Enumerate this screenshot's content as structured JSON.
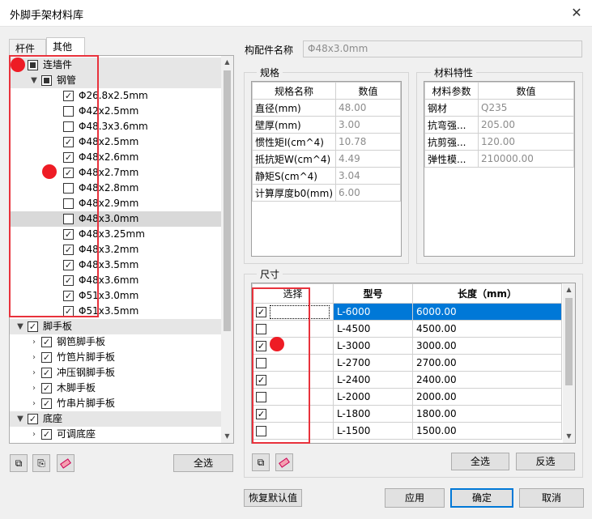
{
  "window": {
    "title": "外脚手架材料库",
    "close_glyph": "✕"
  },
  "tabs": [
    {
      "label": "杆件"
    },
    {
      "label": "其他"
    }
  ],
  "tree": [
    {
      "label": "连墙件",
      "arrow": "▼",
      "check": "partial",
      "indent": 0,
      "group": true
    },
    {
      "label": "钢管",
      "arrow": "▼",
      "check": "partial",
      "indent": 1,
      "group": true
    },
    {
      "label": "Φ26.8x2.5mm",
      "check": true,
      "indent": 2
    },
    {
      "label": "Φ42x2.5mm",
      "check": false,
      "indent": 2
    },
    {
      "label": "Φ48.3x3.6mm",
      "check": false,
      "indent": 2
    },
    {
      "label": "Φ48x2.5mm",
      "check": true,
      "indent": 2
    },
    {
      "label": "Φ48x2.6mm",
      "check": true,
      "indent": 2
    },
    {
      "label": "Φ48x2.7mm",
      "check": true,
      "indent": 2
    },
    {
      "label": "Φ48x2.8mm",
      "check": false,
      "indent": 2
    },
    {
      "label": "Φ48x2.9mm",
      "check": false,
      "indent": 2
    },
    {
      "label": "Φ48x3.0mm",
      "check": false,
      "indent": 2,
      "selected": true
    },
    {
      "label": "Φ48x3.25mm",
      "check": true,
      "indent": 2
    },
    {
      "label": "Φ48x3.2mm",
      "check": true,
      "indent": 2
    },
    {
      "label": "Φ48x3.5mm",
      "check": true,
      "indent": 2
    },
    {
      "label": "Φ48x3.6mm",
      "check": true,
      "indent": 2
    },
    {
      "label": "Φ51x3.0mm",
      "check": true,
      "indent": 2
    },
    {
      "label": "Φ51x3.5mm",
      "check": true,
      "indent": 2
    },
    {
      "label": "脚手板",
      "arrow": "▼",
      "check": true,
      "indent": 0,
      "group": true
    },
    {
      "label": "钢笆脚手板",
      "arrow": "›",
      "check": true,
      "indent": 1
    },
    {
      "label": "竹笆片脚手板",
      "arrow": "›",
      "check": true,
      "indent": 1
    },
    {
      "label": "冲压钢脚手板",
      "arrow": "›",
      "check": true,
      "indent": 1
    },
    {
      "label": "木脚手板",
      "arrow": "›",
      "check": true,
      "indent": 1
    },
    {
      "label": "竹串片脚手板",
      "arrow": "›",
      "check": true,
      "indent": 1
    },
    {
      "label": "底座",
      "arrow": "▼",
      "check": true,
      "indent": 0,
      "group": true
    },
    {
      "label": "可调底座",
      "arrow": "›",
      "check": true,
      "indent": 1
    }
  ],
  "left_buttons": {
    "select_all": "全选"
  },
  "component_name": {
    "label": "构配件名称",
    "value": "Φ48x3.0mm"
  },
  "spec": {
    "title": "规格",
    "headers": [
      "规格名称",
      "数值"
    ],
    "rows": [
      {
        "name": "直径(mm)",
        "value": "48.00"
      },
      {
        "name": "壁厚(mm)",
        "value": "3.00"
      },
      {
        "name": "惯性矩I(cm^4)",
        "value": "10.78"
      },
      {
        "name": "抵抗矩W(cm^4)",
        "value": "4.49"
      },
      {
        "name": "静矩S(cm^4)",
        "value": "3.04"
      },
      {
        "name": "计算厚度b0(mm)",
        "value": "6.00"
      }
    ]
  },
  "material": {
    "title": "材料特性",
    "headers": [
      "材料参数",
      "数值"
    ],
    "rows": [
      {
        "name": "钢材",
        "value": "Q235"
      },
      {
        "name": "抗弯强...",
        "value": "205.00"
      },
      {
        "name": "抗剪强...",
        "value": "120.00"
      },
      {
        "name": "弹性模...",
        "value": "210000.00"
      }
    ]
  },
  "size": {
    "title": "尺寸",
    "headers": [
      "选择",
      "型号",
      "长度（mm）"
    ],
    "rows": [
      {
        "check": true,
        "model": "L-6000",
        "length": "6000.00",
        "selected": true
      },
      {
        "check": false,
        "model": "L-4500",
        "length": "4500.00"
      },
      {
        "check": true,
        "model": "L-3000",
        "length": "3000.00"
      },
      {
        "check": false,
        "model": "L-2700",
        "length": "2700.00"
      },
      {
        "check": true,
        "model": "L-2400",
        "length": "2400.00"
      },
      {
        "check": false,
        "model": "L-2000",
        "length": "2000.00"
      },
      {
        "check": true,
        "model": "L-1800",
        "length": "1800.00"
      },
      {
        "check": false,
        "model": "L-1500",
        "length": "1500.00"
      }
    ]
  },
  "size_buttons": {
    "select_all": "全选",
    "invert": "反选"
  },
  "footer": {
    "restore": "恢复默认值",
    "apply": "应用",
    "ok": "确定",
    "cancel": "取消"
  },
  "icons": {
    "copy": "copy-icon",
    "paste": "paste-icon",
    "eraser": "eraser-icon"
  },
  "colors": {
    "highlight_box": "#e8323c",
    "marker_dot": "#ee1c25",
    "selection": "#0078d7"
  }
}
